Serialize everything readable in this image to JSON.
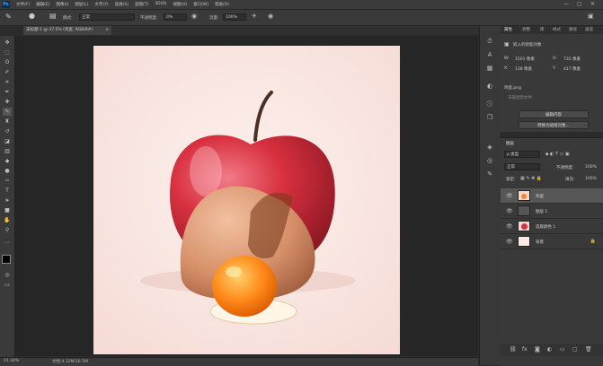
{
  "app": {
    "logo": "Ps"
  },
  "menu": [
    "文件(F)",
    "编辑(E)",
    "图像(I)",
    "图层(L)",
    "文字(Y)",
    "选择(S)",
    "滤镜(T)",
    "3D(D)",
    "视图(V)",
    "窗口(W)",
    "帮助(H)"
  ],
  "window_controls": {
    "min": "—",
    "max": "▢",
    "close": "✕"
  },
  "options": {
    "mode_label": "模式:",
    "mode_value": "正常",
    "opacity_label": "不透明度:",
    "opacity_value": "0%",
    "flow_label": "流量:",
    "flow_value": "100%"
  },
  "document": {
    "tab_title": "未标题-1 @ 47.5% (鸡蛋, RGB/8#)",
    "tab_close": "×"
  },
  "status": {
    "zoom": "41.34%",
    "doc": "文档:4.12M/16.5M"
  },
  "properties": {
    "tabs": [
      "属性",
      "调整",
      "库",
      "样式",
      "路径",
      "通道"
    ],
    "smart_label": "嵌入的智能对象",
    "w_label": "W:",
    "w_value": "1501 像素",
    "h_label": "H:",
    "h_value": "735 像素",
    "x_label": "X:",
    "x_value": "138 像素",
    "y_label": "Y:",
    "y_value": "417 像素",
    "layer_name": "鸡蛋.png",
    "file_hint": "未链接到文件",
    "edit_button": "编辑内容",
    "convert_button": "转换为链接对象..."
  },
  "layers": {
    "title": "图层",
    "filter_label": "ρ 类型",
    "blend": "正常",
    "opacity_label": "不透明度:",
    "opacity_value": "100%",
    "lock_label": "锁定:",
    "fill_label": "填充:",
    "fill_value": "100%",
    "items": [
      {
        "name": "鸡蛋",
        "selected": true
      },
      {
        "name": "图层 1",
        "selected": false
      },
      {
        "name": "选取颜色 1",
        "selected": false
      },
      {
        "name": "背景",
        "selected": false
      }
    ],
    "footer_icons": [
      "link-icon",
      "fx-icon",
      "mask-icon",
      "adjustment-icon",
      "group-icon",
      "new-layer-icon",
      "trash-icon"
    ]
  },
  "colors": {
    "accent": "#3fa3ff",
    "canvas_bg": "#f9e6e1",
    "apple_red": "#d8303f",
    "egg_shell": "#d6906a",
    "yolk": "#ff8a1a"
  },
  "tool_icons": [
    "move-icon",
    "marquee-icon",
    "lasso-icon",
    "quick-select-icon",
    "crop-icon",
    "eyedropper-icon",
    "healing-icon",
    "brush-icon",
    "stamp-icon",
    "history-brush-icon",
    "eraser-icon",
    "gradient-icon",
    "blur-icon",
    "dodge-icon",
    "pen-icon",
    "type-icon",
    "path-select-icon",
    "shape-icon",
    "hand-icon",
    "zoom-icon"
  ]
}
